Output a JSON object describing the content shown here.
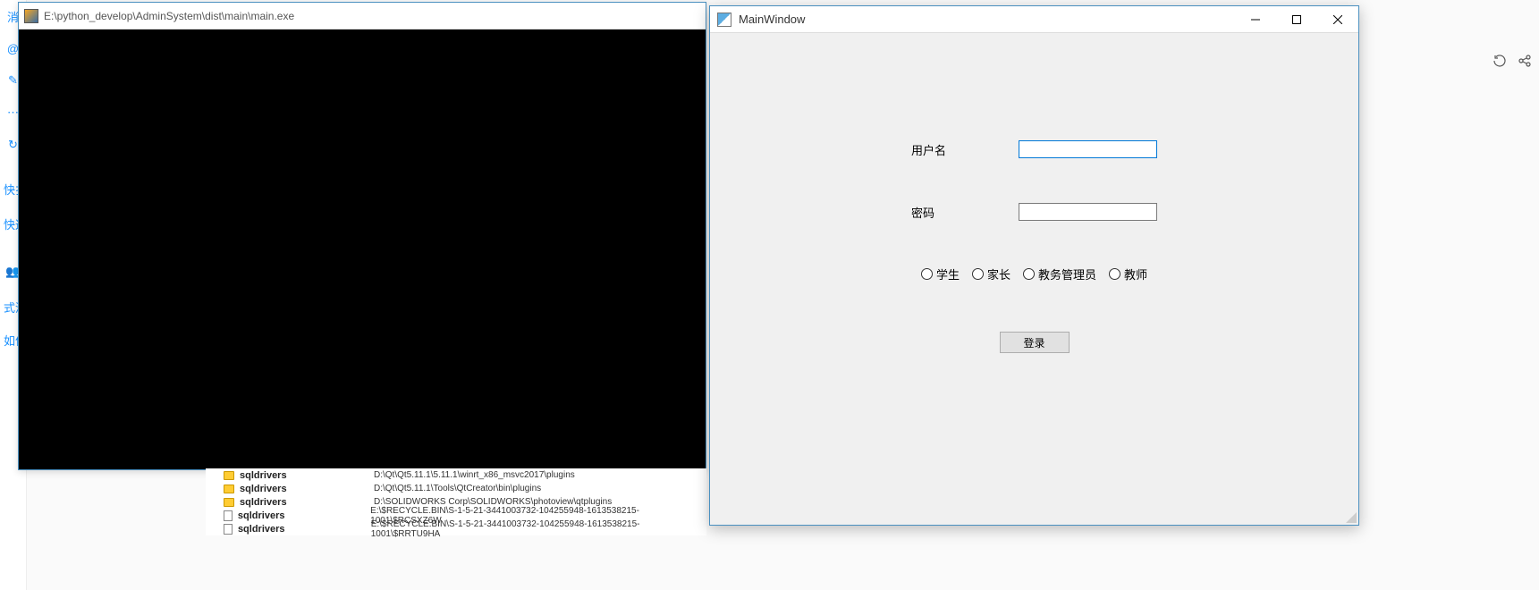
{
  "sidebar": {
    "items": [
      "消",
      "@",
      "✎",
      "⋯",
      "↻"
    ],
    "group_icon": "👥",
    "text1": "快扌",
    "text2": "快这",
    "text3": "式没",
    "text4": "如何"
  },
  "console": {
    "title": "E:\\python_develop\\AdminSystem\\dist\\main\\main.exe"
  },
  "files": [
    {
      "type": "folder",
      "name": "sqldrivers",
      "path": "D:\\Qt\\Qt5.11.1\\5.11.1\\winrt_x86_msvc2017\\plugins"
    },
    {
      "type": "folder",
      "name": "sqldrivers",
      "path": "D:\\Qt\\Qt5.11.1\\Tools\\QtCreator\\bin\\plugins"
    },
    {
      "type": "folder",
      "name": "sqldrivers",
      "path": "D:\\SOLIDWORKS Corp\\SOLIDWORKS\\photoview\\qtplugins"
    },
    {
      "type": "file",
      "name": "sqldrivers",
      "path": "E:\\$RECYCLE.BIN\\S-1-5-21-3441003732-104255948-1613538215-1001\\$RCSXZ6W"
    },
    {
      "type": "file",
      "name": "sqldrivers",
      "path": "E:\\$RECYCLE.BIN\\S-1-5-21-3441003732-104255948-1613538215-1001\\$RRTU9HA"
    }
  ],
  "qt": {
    "title": "MainWindow",
    "username_label": "用户名",
    "password_label": "密码",
    "username_value": "",
    "password_value": "",
    "roles": [
      "学生",
      "家长",
      "教务管理员",
      "教师"
    ],
    "login_label": "登录"
  },
  "topright": {
    "refresh": "⟳",
    "share": "↗"
  }
}
